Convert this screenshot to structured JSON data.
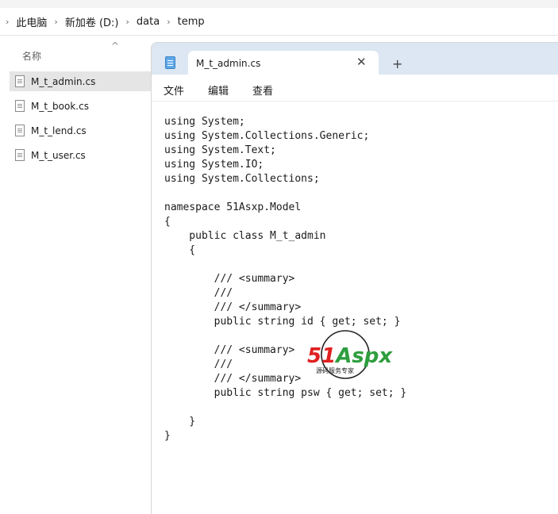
{
  "breadcrumb": {
    "items": [
      "此电脑",
      "新加卷 (D:)",
      "data",
      "temp"
    ]
  },
  "sidebar": {
    "column_header": "名称",
    "files": [
      "M_t_admin.cs",
      "M_t_book.cs",
      "M_t_lend.cs",
      "M_t_user.cs"
    ],
    "selected_index": 0
  },
  "notepad": {
    "tab_title": "M_t_admin.cs",
    "close_glyph": "✕",
    "new_tab_glyph": "+",
    "menu": {
      "file": "文件",
      "edit": "编辑",
      "view": "查看"
    },
    "code_lines": [
      "using System;",
      "using System.Collections.Generic;",
      "using System.Text;",
      "using System.IO;",
      "using System.Collections;",
      "",
      "namespace 51Asxp.Model",
      "{",
      "    public class M_t_admin",
      "    {",
      "",
      "        /// <summary>",
      "        ///",
      "        /// </summary>",
      "        public string id { get; set; }",
      "",
      "        /// <summary>",
      "        ///",
      "        /// </summary>",
      "        public string psw { get; set; }",
      "",
      "    }",
      "}"
    ]
  },
  "watermark": {
    "logo": "51Aspx",
    "slogan": "源码服务专家"
  },
  "colors": {
    "titlebar": "#dce7f3",
    "selected_file": "#e5e5e5",
    "logo_red": "#e02020",
    "logo_green": "#2e9e3e"
  }
}
